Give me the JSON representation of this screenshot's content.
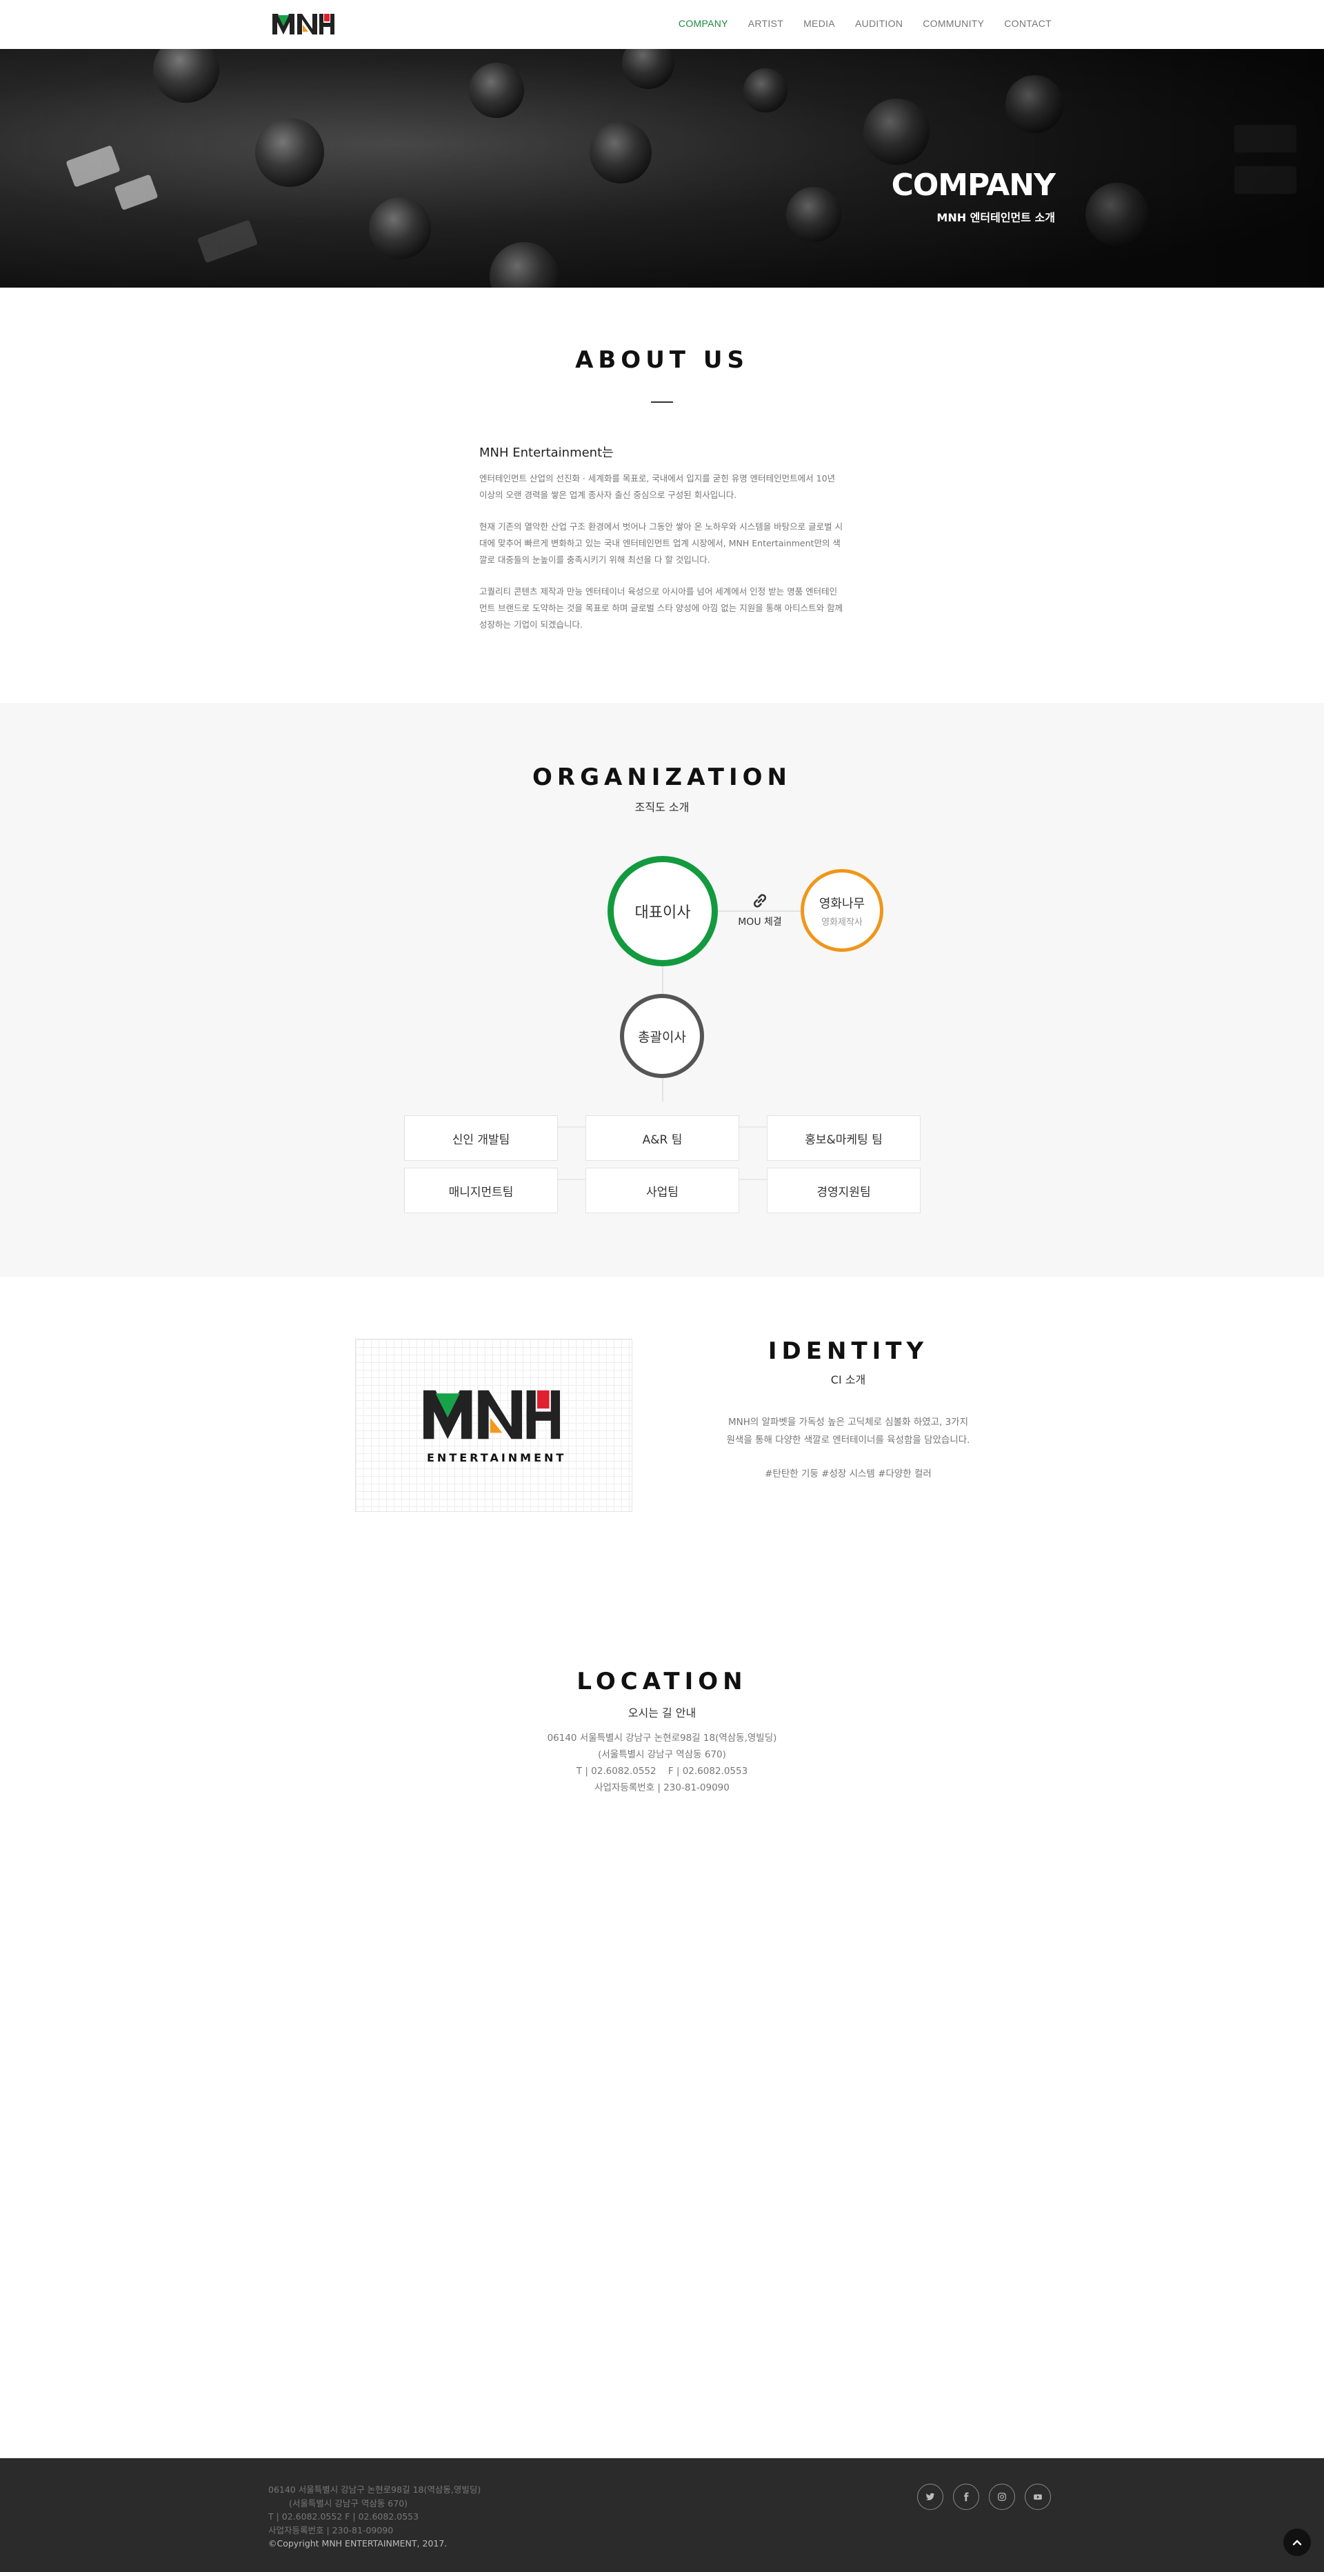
{
  "header": {
    "logo_text": "MNH",
    "nav": [
      "COMPANY",
      "ARTIST",
      "MEDIA",
      "AUDITION",
      "COMMUNITY",
      "CONTACT"
    ],
    "active_nav": "COMPANY",
    "accent_color": "#1a8a3c"
  },
  "hero": {
    "title": "COMPANY",
    "subtitle": "MNH 엔터테인먼트 소개"
  },
  "about": {
    "title": "ABOUT US",
    "heading": "MNH Entertainment는",
    "paragraphs": [
      "엔터테인먼트 산업의 선진화 · 세계화를 목표로, 국내에서 입지를 굳힌 유명 엔터테인먼트에서 10년 이상의 오랜 경력을 쌓은 업계 종사자 출신 중심으로 구성된 회사입니다.",
      "현재 기존의 열악한 산업 구조 환경에서 벗어나 그동안 쌓아 온 노하우와 시스템을 바탕으로 글로벌 시대에 맞추어 빠르게 변화하고 있는 국내 엔터테인먼트 업계 시장에서, MNH Entertainment만의 색깔로 대중들의 눈높이를 충족시키기 위해 최선을 다 할 것입니다.",
      "고퀄리티 콘텐츠 제작과 만능 엔터테이너 육성으로 아시아를 넘어 세계에서 인정 받는 명품 엔터테인먼트 브랜드로 도약하는 것을 목표로 하며 글로벌 스타 양성에 아낌 없는 지원을 통해 아티스트와 함께 성장하는 기업이 되겠습니다."
    ]
  },
  "organization": {
    "title": "ORGANIZATION",
    "subtitle": "조직도 소개",
    "ceo": "대표이사",
    "partner": "영화나무",
    "partner_sub": "영화제작사",
    "mou": "MOU 체결",
    "gm": "총괄이사",
    "teams": [
      "신인 개발팀",
      "A&R 팀",
      "홍보&마케팅 팀",
      "매니지먼트팀",
      "사업팀",
      "경영지원팀"
    ],
    "colors": {
      "ceo": "#139a3f",
      "partner": "#f0961a",
      "gm": "#555555"
    }
  },
  "identity": {
    "title": "IDENTITY",
    "subtitle": "CI 소개",
    "logo_text": "MNH",
    "logo_caption": "ENTERTAINMENT",
    "desc_line1": "MNH의 알파벳을 가독성 높은 고딕체로 심볼화 하였고, 3가지",
    "desc_line2": "원색을 통해 다양한 색깔로 엔터테이너를 육성함을 담았습니다.",
    "tags": "#탄탄한 기둥 #성장 시스템 #다양한 컬러",
    "colors": {
      "green": "#17a34a",
      "orange": "#f39a1e",
      "red": "#e0202f",
      "dark": "#222222"
    }
  },
  "location": {
    "title": "LOCATION",
    "subtitle": "오시는 길 안내",
    "lines": [
      "06140 서울특별시 강남구 논현로98길 18(역삼동,영빌딩)",
      "(서울특별시 강남구 역삼동 670)",
      "T | 02.6082.0552    F | 02.6082.0553",
      "사업자등록번호 | 230-81-09090"
    ]
  },
  "footer": {
    "lines": [
      "06140  서울특별시 강남구 논현로98길 18(역삼동,영빌딩)",
      "(서울특별시 강남구 역삼동 670)",
      "T | 02.6082.0552  F | 02.6082.0553",
      "사업자등록번호 | 230-81-09090"
    ],
    "copyright": "©Copyright MNH ENTERTAINMENT, 2017.",
    "social": [
      "twitter-icon",
      "facebook-icon",
      "instagram-icon",
      "youtube-icon"
    ]
  }
}
